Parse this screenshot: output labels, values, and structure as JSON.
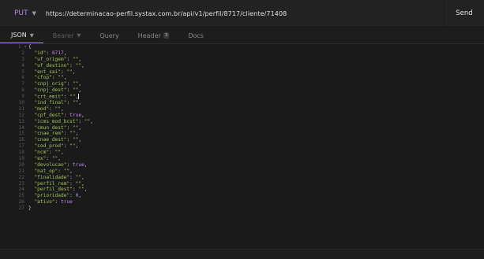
{
  "request": {
    "method": "PUT",
    "url": "https://determinacao-perfil.systax.com.br/api/v1/perfil/8717/cliente/71408",
    "send_label": "Send"
  },
  "tabs": [
    {
      "label": "JSON",
      "active": true,
      "dropdown": true
    },
    {
      "label": "Bearer",
      "active": false,
      "dropdown": true
    },
    {
      "label": "Query",
      "active": false
    },
    {
      "label": "Header",
      "active": false,
      "badge": "3"
    },
    {
      "label": "Docs",
      "active": false
    }
  ],
  "body_lines": [
    {
      "num": "1",
      "key": "",
      "value": "",
      "type": "open"
    },
    {
      "num": "2",
      "key": "\"id\"",
      "value": "8717",
      "type": "num",
      "comma": true
    },
    {
      "num": "3",
      "key": "\"uf_origem\"",
      "value": "\"\"",
      "type": "str",
      "comma": true
    },
    {
      "num": "4",
      "key": "\"uf_destino\"",
      "value": "\"\"",
      "type": "str",
      "comma": true
    },
    {
      "num": "5",
      "key": "\"ent_sai\"",
      "value": "\"\"",
      "type": "str",
      "comma": true
    },
    {
      "num": "6",
      "key": "\"cfop\"",
      "value": "\"\"",
      "type": "str",
      "comma": true
    },
    {
      "num": "7",
      "key": "\"cnpj_orig\"",
      "value": "\"\"",
      "type": "str",
      "comma": true
    },
    {
      "num": "8",
      "key": "\"cnpj_dest\"",
      "value": "\"\"",
      "type": "str",
      "comma": true
    },
    {
      "num": "9",
      "key": "\"crt_emit\"",
      "value": "\"\"",
      "type": "str",
      "comma": true,
      "cursor": true
    },
    {
      "num": "10",
      "key": "\"ind_final\"",
      "value": "\"\"",
      "type": "str",
      "comma": true
    },
    {
      "num": "11",
      "key": "\"mod\"",
      "value": "\"\"",
      "type": "str",
      "comma": true
    },
    {
      "num": "12",
      "key": "\"cpf_dest\"",
      "value": "true",
      "type": "bool",
      "comma": true
    },
    {
      "num": "13",
      "key": "\"icms_mod_bcst\"",
      "value": "\"\"",
      "type": "str",
      "comma": true
    },
    {
      "num": "14",
      "key": "\"cmun_dest\"",
      "value": "\"\"",
      "type": "str",
      "comma": true
    },
    {
      "num": "15",
      "key": "\"cnae_rem\"",
      "value": "\"\"",
      "type": "str",
      "comma": true
    },
    {
      "num": "16",
      "key": "\"cnae_dest\"",
      "value": "\"\"",
      "type": "str",
      "comma": true
    },
    {
      "num": "17",
      "key": "\"cod_prod\"",
      "value": "\"\"",
      "type": "str",
      "comma": true
    },
    {
      "num": "18",
      "key": "\"ncm\"",
      "value": "\"\"",
      "type": "str",
      "comma": true
    },
    {
      "num": "19",
      "key": "\"ex\"",
      "value": "\"\"",
      "type": "str",
      "comma": true
    },
    {
      "num": "20",
      "key": "\"devolucao\"",
      "value": "true",
      "type": "bool",
      "comma": true
    },
    {
      "num": "21",
      "key": "\"nat_op\"",
      "value": "\"\"",
      "type": "str",
      "comma": true
    },
    {
      "num": "22",
      "key": "\"finalidade\"",
      "value": "\"\"",
      "type": "str",
      "comma": true
    },
    {
      "num": "23",
      "key": "\"perfil_rem\"",
      "value": "\"\"",
      "type": "str",
      "comma": true
    },
    {
      "num": "24",
      "key": "\"perfil_dest\"",
      "value": "\"\"",
      "type": "str",
      "comma": true
    },
    {
      "num": "25",
      "key": "\"prioridade\"",
      "value": "0",
      "type": "num",
      "comma": true
    },
    {
      "num": "26",
      "key": "\"ativo\"",
      "value": "true",
      "type": "bool",
      "comma": false
    },
    {
      "num": "27",
      "key": "",
      "value": "",
      "type": "close"
    }
  ],
  "colors": {
    "method": "#b084eb",
    "string": "#a6c45a",
    "literal": "#c086e8",
    "background": "#1a1a1a"
  }
}
